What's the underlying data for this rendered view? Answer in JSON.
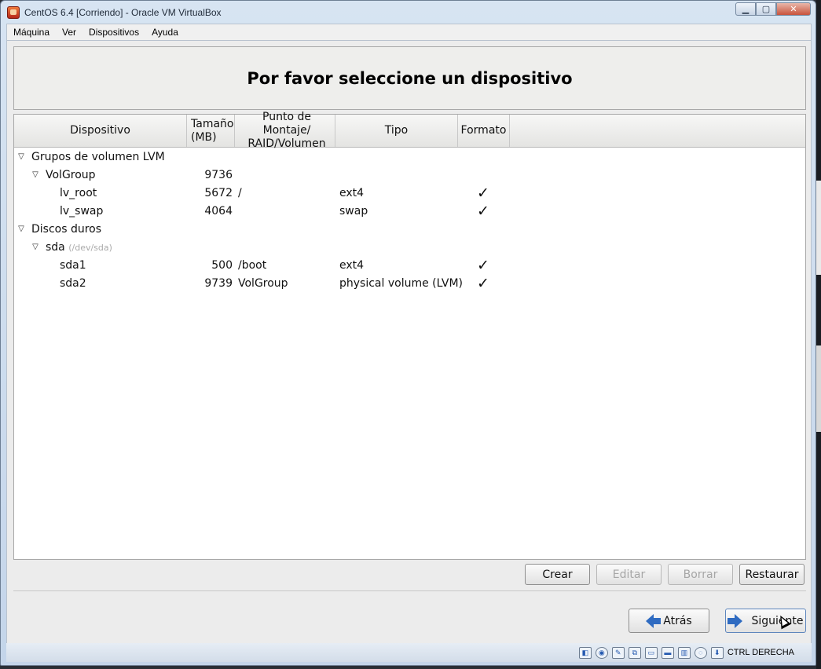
{
  "window": {
    "title": "CentOS 6.4 [Corriendo] - Oracle VM VirtualBox",
    "controls": {
      "minimize": "▁",
      "maximize": "▢",
      "close": "✕"
    }
  },
  "menubar": [
    "Máquina",
    "Ver",
    "Dispositivos",
    "Ayuda"
  ],
  "installer": {
    "heading": "Por favor seleccione un dispositivo",
    "columns": {
      "device": "Dispositivo",
      "size_line1": "Tamaño",
      "size_line2": "(MB)",
      "mount_line1": "Punto de Montaje/",
      "mount_line2": "RAID/Volumen",
      "type": "Tipo",
      "format": "Formato"
    },
    "rows": [
      {
        "name": "Grupos de volumen LVM",
        "size": "",
        "mount": "",
        "type": "",
        "format": ""
      },
      {
        "name": "VolGroup",
        "size": "9736",
        "mount": "",
        "type": "",
        "format": ""
      },
      {
        "name": "lv_root",
        "size": "5672",
        "mount": "/",
        "type": "ext4",
        "format": "✓"
      },
      {
        "name": "lv_swap",
        "size": "4064",
        "mount": "",
        "type": "swap",
        "format": "✓"
      },
      {
        "name": "Discos duros",
        "size": "",
        "mount": "",
        "type": "",
        "format": ""
      },
      {
        "name": "sda",
        "path": "(/dev/sda)",
        "size": "",
        "mount": "",
        "type": "",
        "format": ""
      },
      {
        "name": "sda1",
        "size": "500",
        "mount": "/boot",
        "type": "ext4",
        "format": "✓"
      },
      {
        "name": "sda2",
        "size": "9739",
        "mount": "VolGroup",
        "type": "physical volume (LVM)",
        "format": "✓"
      }
    ],
    "expander_glyph": "▽",
    "buttons": {
      "create": "Crear",
      "edit": "Editar",
      "delete": "Borrar",
      "reset": "Restaurar",
      "back": "Atrás",
      "next": "Siguiente"
    }
  },
  "statusbar": {
    "icons": [
      "hard-disk-icon",
      "optical-drive-icon",
      "usb-icon",
      "network-icon",
      "shared-folders-icon",
      "display-icon",
      "video-capture-icon",
      "mouse-integration-icon",
      "keyboard-capture-icon"
    ],
    "host_key": "CTRL DERECHA"
  }
}
